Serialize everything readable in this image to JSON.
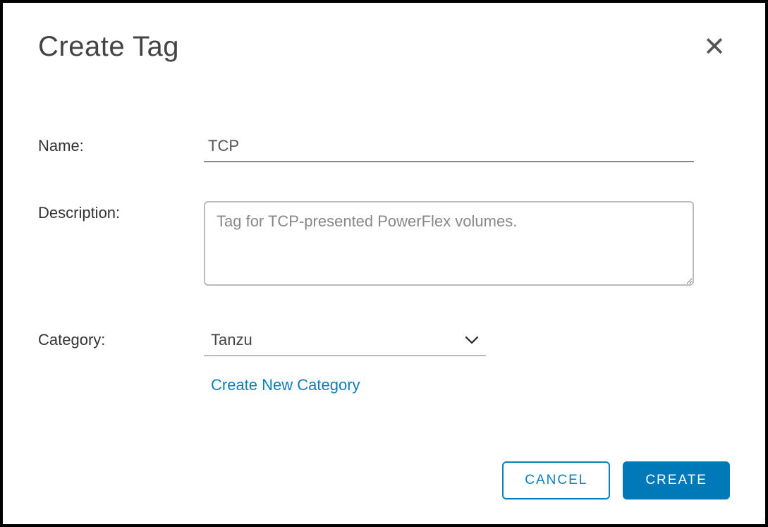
{
  "dialog": {
    "title": "Create Tag",
    "close_label": "✕"
  },
  "form": {
    "name": {
      "label": "Name:",
      "value": "TCP"
    },
    "description": {
      "label": "Description:",
      "value": "Tag for TCP-presented PowerFlex volumes."
    },
    "category": {
      "label": "Category:",
      "selected": "Tanzu",
      "create_link": "Create New Category"
    }
  },
  "footer": {
    "cancel": "CANCEL",
    "create": "CREATE"
  }
}
